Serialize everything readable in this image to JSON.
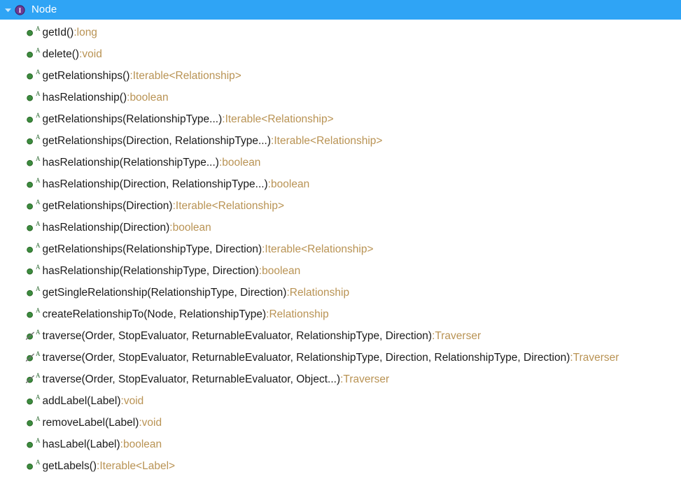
{
  "panel": {
    "name": "java-type-outline",
    "header": {
      "label": "Node",
      "icon": "interface-icon",
      "icon_letter": "I",
      "disclosure": "chevron-down-icon",
      "background_color": "#2fa4f5",
      "text_color": "#ffffff"
    },
    "colors": {
      "member_icon_green": "#3c8c3f",
      "return_type": "#b99354",
      "signature": "#1b1b1b",
      "modifier_mark": "#2d6a32",
      "panel_background": "#ffffff"
    },
    "members": [
      {
        "icon": "method-public-icon",
        "modifier": "A",
        "deprecated": false,
        "signature": "getId()",
        "separator": " : ",
        "return_type": "long"
      },
      {
        "icon": "method-public-icon",
        "modifier": "A",
        "deprecated": false,
        "signature": "delete()",
        "separator": " : ",
        "return_type": "void"
      },
      {
        "icon": "method-public-icon",
        "modifier": "A",
        "deprecated": false,
        "signature": "getRelationships()",
        "separator": " : ",
        "return_type": "Iterable<Relationship>"
      },
      {
        "icon": "method-public-icon",
        "modifier": "A",
        "deprecated": false,
        "signature": "hasRelationship()",
        "separator": " : ",
        "return_type": "boolean"
      },
      {
        "icon": "method-public-icon",
        "modifier": "A",
        "deprecated": false,
        "signature": "getRelationships(RelationshipType...)",
        "separator": " : ",
        "return_type": "Iterable<Relationship>"
      },
      {
        "icon": "method-public-icon",
        "modifier": "A",
        "deprecated": false,
        "signature": "getRelationships(Direction, RelationshipType...)",
        "separator": " : ",
        "return_type": "Iterable<Relationship>"
      },
      {
        "icon": "method-public-icon",
        "modifier": "A",
        "deprecated": false,
        "signature": "hasRelationship(RelationshipType...)",
        "separator": " : ",
        "return_type": "boolean"
      },
      {
        "icon": "method-public-icon",
        "modifier": "A",
        "deprecated": false,
        "signature": "hasRelationship(Direction, RelationshipType...)",
        "separator": " : ",
        "return_type": "boolean"
      },
      {
        "icon": "method-public-icon",
        "modifier": "A",
        "deprecated": false,
        "signature": "getRelationships(Direction)",
        "separator": " : ",
        "return_type": "Iterable<Relationship>"
      },
      {
        "icon": "method-public-icon",
        "modifier": "A",
        "deprecated": false,
        "signature": "hasRelationship(Direction)",
        "separator": " : ",
        "return_type": "boolean"
      },
      {
        "icon": "method-public-icon",
        "modifier": "A",
        "deprecated": false,
        "signature": "getRelationships(RelationshipType, Direction)",
        "separator": " : ",
        "return_type": "Iterable<Relationship>"
      },
      {
        "icon": "method-public-icon",
        "modifier": "A",
        "deprecated": false,
        "signature": "hasRelationship(RelationshipType, Direction)",
        "separator": " : ",
        "return_type": "boolean"
      },
      {
        "icon": "method-public-icon",
        "modifier": "A",
        "deprecated": false,
        "signature": "getSingleRelationship(RelationshipType, Direction)",
        "separator": " : ",
        "return_type": "Relationship"
      },
      {
        "icon": "method-public-icon",
        "modifier": "A",
        "deprecated": false,
        "signature": "createRelationshipTo(Node, RelationshipType)",
        "separator": " : ",
        "return_type": "Relationship"
      },
      {
        "icon": "method-public-deprecated-icon",
        "modifier": "A",
        "deprecated": true,
        "signature": "traverse(Order, StopEvaluator, ReturnableEvaluator, RelationshipType, Direction)",
        "separator": " : ",
        "return_type": "Traverser"
      },
      {
        "icon": "method-public-deprecated-icon",
        "modifier": "A",
        "deprecated": true,
        "signature": "traverse(Order, StopEvaluator, ReturnableEvaluator, RelationshipType, Direction, RelationshipType, Direction)",
        "separator": " : ",
        "return_type": "Traverser"
      },
      {
        "icon": "method-public-deprecated-icon",
        "modifier": "A",
        "deprecated": true,
        "signature": "traverse(Order, StopEvaluator, ReturnableEvaluator, Object...)",
        "separator": " : ",
        "return_type": "Traverser"
      },
      {
        "icon": "method-public-icon",
        "modifier": "A",
        "deprecated": false,
        "signature": "addLabel(Label)",
        "separator": " : ",
        "return_type": "void"
      },
      {
        "icon": "method-public-icon",
        "modifier": "A",
        "deprecated": false,
        "signature": "removeLabel(Label)",
        "separator": " : ",
        "return_type": "void"
      },
      {
        "icon": "method-public-icon",
        "modifier": "A",
        "deprecated": false,
        "signature": "hasLabel(Label)",
        "separator": " : ",
        "return_type": "boolean"
      },
      {
        "icon": "method-public-icon",
        "modifier": "A",
        "deprecated": false,
        "signature": "getLabels()",
        "separator": " : ",
        "return_type": "Iterable<Label>"
      }
    ]
  }
}
